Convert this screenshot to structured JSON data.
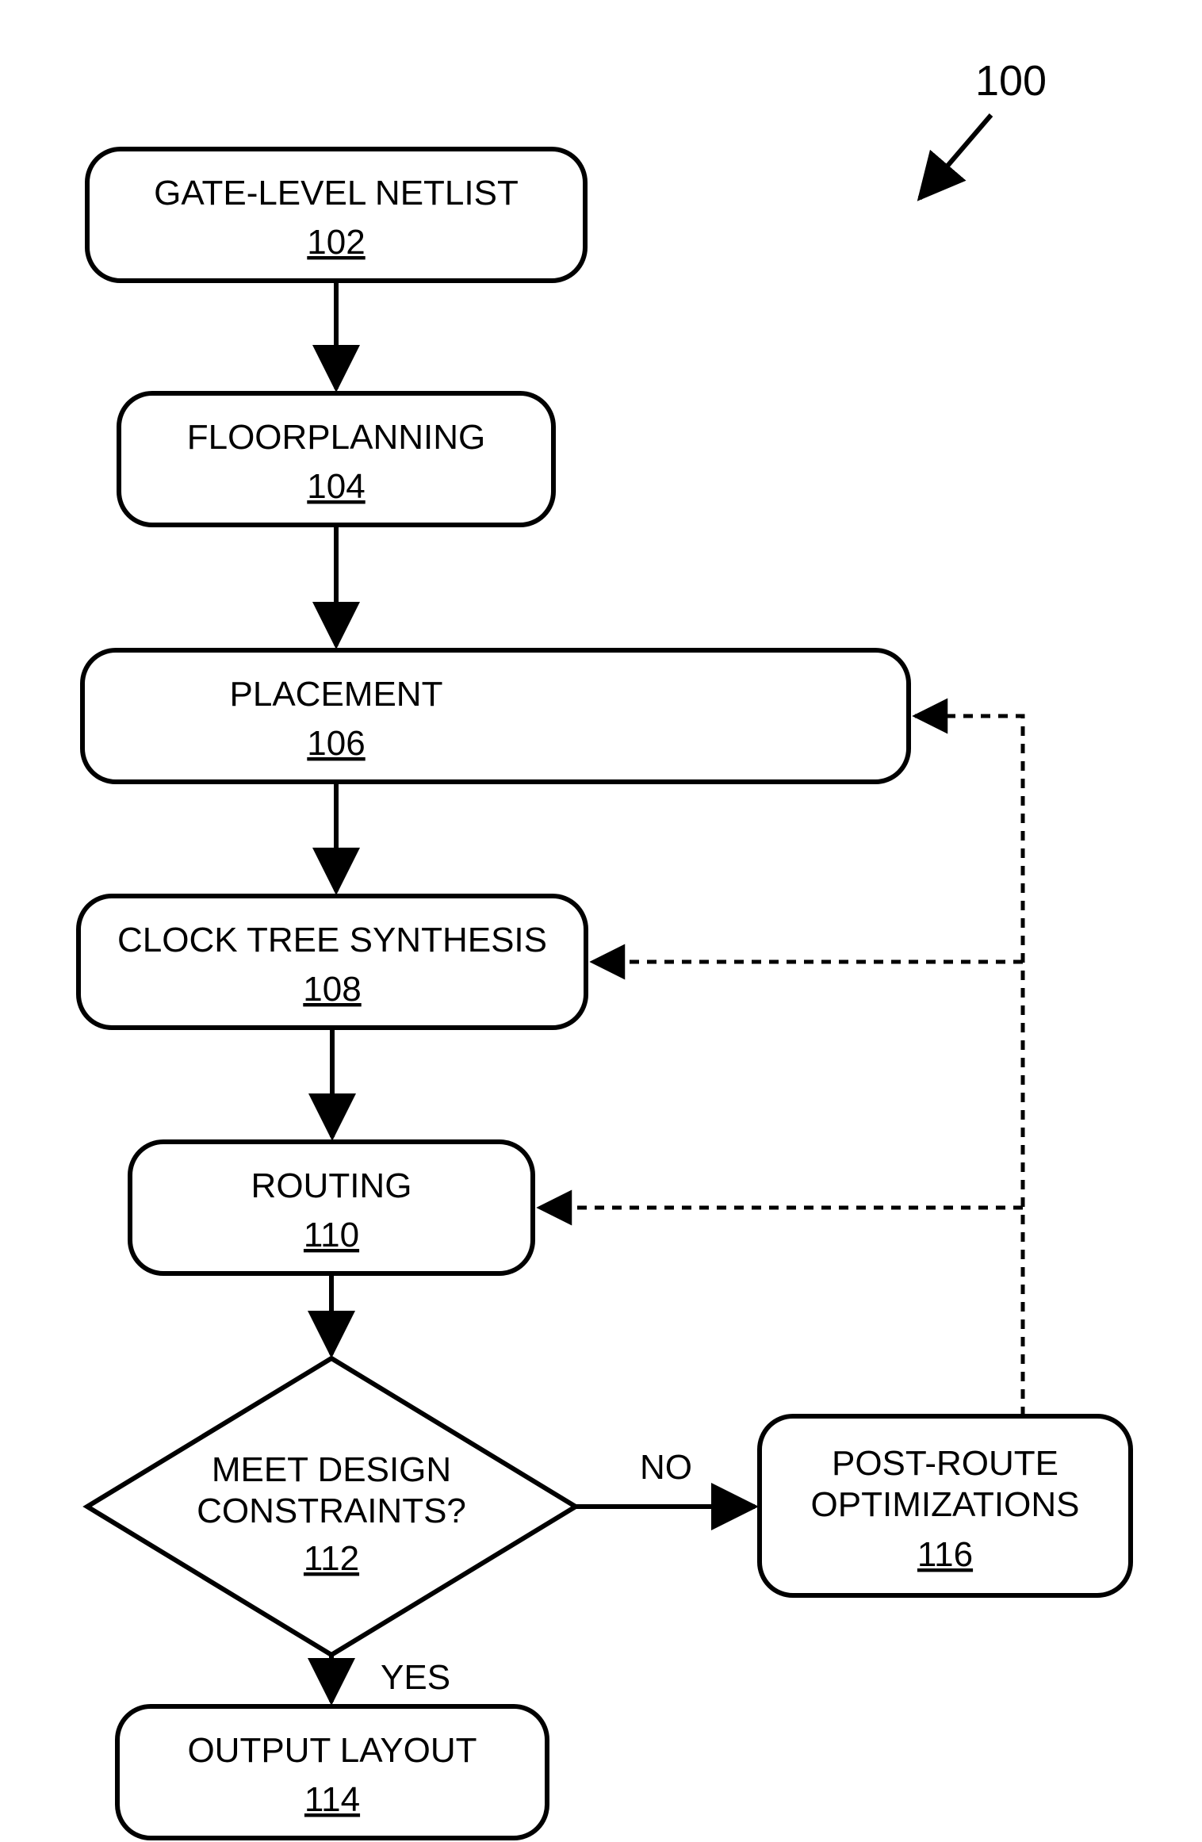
{
  "figure_label": "100",
  "nodes": {
    "n102": {
      "label": "GATE-LEVEL NETLIST",
      "ref": "102"
    },
    "n104": {
      "label": "FLOORPLANNING",
      "ref": "104"
    },
    "n106": {
      "label": "PLACEMENT",
      "ref": "106"
    },
    "n108": {
      "label": "CLOCK TREE SYNTHESIS",
      "ref": "108"
    },
    "n110": {
      "label": "ROUTING",
      "ref": "110"
    },
    "n112": {
      "line1": "MEET DESIGN",
      "line2": "CONSTRAINTS?",
      "ref": "112"
    },
    "n114": {
      "label": "OUTPUT LAYOUT",
      "ref": "114"
    },
    "n116": {
      "line1": "POST-ROUTE",
      "line2": "OPTIMIZATIONS",
      "ref": "116"
    }
  },
  "edge_labels": {
    "no": "NO",
    "yes": "YES"
  }
}
